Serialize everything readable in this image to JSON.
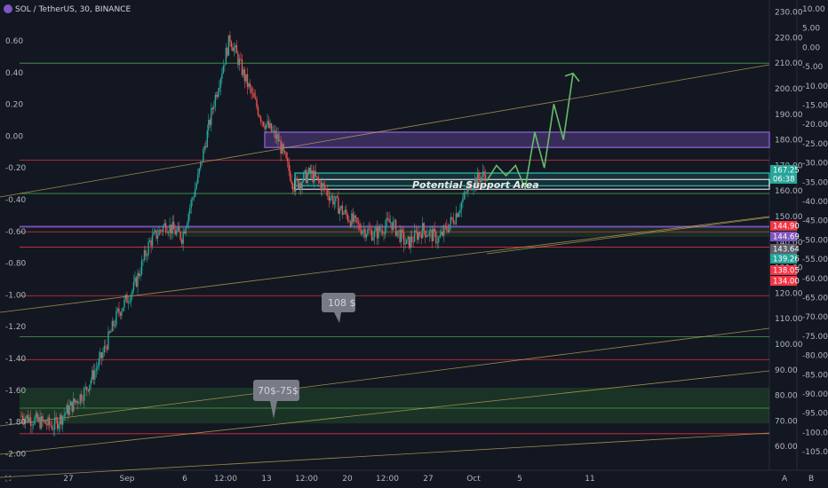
{
  "chart_data": {
    "type": "candlestick",
    "title": "SOL / TetherUS, 30, BINANCE",
    "symbol": "SOL / TetherUS",
    "interval": "30",
    "exchange": "BINANCE",
    "right_axis_ticks": [
      "230.00",
      "220.00",
      "210.00",
      "200.00",
      "190.00",
      "180.00",
      "170.00",
      "160.00",
      "150.00",
      "140.00",
      "130.00",
      "120.00",
      "110.00",
      "100.00",
      "90.00",
      "80.00",
      "70.00",
      "60.00"
    ],
    "left_axis_ticks": [
      "0.60",
      "0.40",
      "0.20",
      "0.00",
      "-0.20",
      "-0.40",
      "-0.60",
      "-0.80",
      "-1.00",
      "-1.20",
      "-1.40",
      "-1.60",
      "-1.80",
      "-2.00"
    ],
    "far_right_axis_ticks": [
      "10.00",
      "5.00",
      "0.00",
      "-5.00",
      "-10.00",
      "-15.00",
      "-20.00",
      "-25.00",
      "-30.00",
      "-35.00",
      "-40.00",
      "-45.00",
      "-50.00",
      "-55.00",
      "-60.00",
      "-65.00",
      "-70.00",
      "-75.00",
      "-80.00",
      "-85.00",
      "-90.00",
      "-95.00",
      "-100.00",
      "-105.00"
    ],
    "x_axis_ticks": [
      "27",
      "Sep",
      "6",
      "12:00",
      "13",
      "12:00",
      "20",
      "12:00",
      "27",
      "Oct",
      "5",
      "11"
    ],
    "price_labels": [
      {
        "text": "167.25",
        "color": "#26a69a"
      },
      {
        "text": "06:38",
        "color": "#26a69a"
      },
      {
        "text": "144.90",
        "color": "#f23645"
      },
      {
        "text": "144.69",
        "color": "#7e57c2"
      },
      {
        "text": "143.64",
        "color": "#5d606b"
      },
      {
        "text": "139.26",
        "color": "#26a69a"
      },
      {
        "text": "138.05",
        "color": "#f23645"
      },
      {
        "text": "134.00",
        "color": "#f23645"
      }
    ],
    "horizontal_levels": {
      "green": [
        210,
        159,
        103,
        75
      ],
      "red": [
        172,
        144,
        138,
        119,
        94,
        65
      ],
      "purple": [
        146
      ]
    },
    "zones": [
      {
        "name": "resistance box",
        "from": 177,
        "to": 183,
        "color": "#7e57c2"
      },
      {
        "name": "support box",
        "from": 162,
        "to": 167,
        "color": "#26a69a"
      },
      {
        "name": "70$-75$ zone",
        "from": 69,
        "to": 83,
        "color": "#1b5e20"
      }
    ],
    "annotations": [
      "Potential Support Area",
      "108 $",
      "70$-75$"
    ],
    "projection_path": [
      164,
      170,
      166,
      170,
      161,
      183,
      169,
      194,
      180,
      206
    ],
    "candles_approx_close": [
      72,
      70,
      68,
      75,
      82,
      95,
      112,
      122,
      140,
      147,
      142,
      165,
      195,
      220,
      203,
      188,
      180,
      162,
      167,
      160,
      152,
      146,
      143,
      148,
      139,
      145,
      141,
      150,
      163,
      167
    ],
    "xlabel": "",
    "ylabel": ""
  },
  "bottom_buttons": {
    "left": "⛶",
    "a": "A",
    "b": "B"
  }
}
